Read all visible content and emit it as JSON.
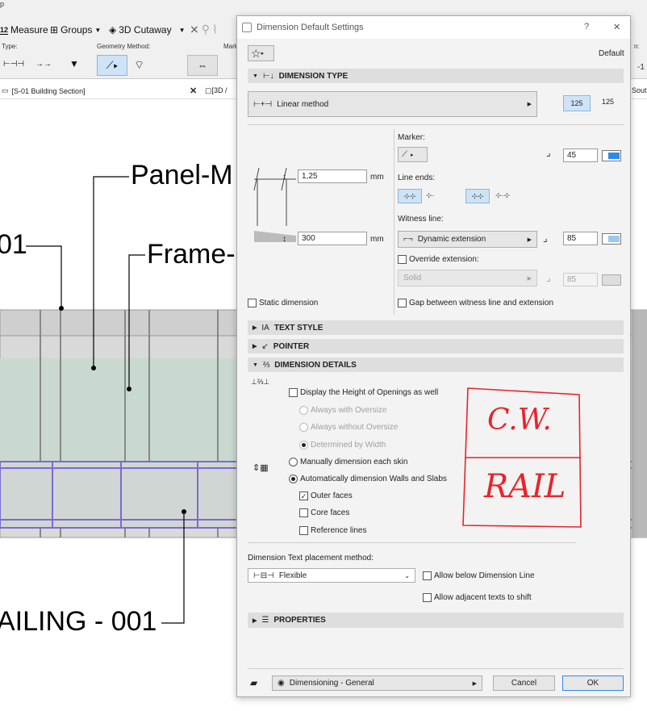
{
  "toolbar": {
    "measure": "Measure",
    "groups": "Groups",
    "cutaway": "3D Cutaway",
    "type_label": "Type:",
    "geometry_label": "Geometry Method:",
    "mark_label": "Mark",
    "tab_label": "[S-01 Building Section]",
    "tab2_label": "[3D /"
  },
  "canvas": {
    "label_01": "01",
    "label_panel": "Panel-M",
    "label_frame": "Frame-",
    "label_railing": "AILING - 001",
    "handwriting_cw": "C.W.",
    "handwriting_rail": "RAIL"
  },
  "dialog": {
    "title": "Dimension Default Settings",
    "help": "?",
    "close": "✕",
    "default_label": "Default",
    "sections": {
      "dimension_type": "DIMENSION TYPE",
      "text_style": "TEXT STYLE",
      "pointer": "POINTER",
      "dimension_details": "DIMENSION DETAILS",
      "properties": "PROPERTIES"
    },
    "dim_type": {
      "method": "Linear method",
      "preview_a": "125",
      "preview_b": "125"
    },
    "geometry": {
      "offset_value": "1,25",
      "offset_unit": "mm",
      "witness_value": "300",
      "witness_unit": "mm",
      "static_dimension": "Static dimension"
    },
    "marker": {
      "label": "Marker:",
      "size": "45",
      "line_ends_label": "Line ends:",
      "witness_label": "Witness line:",
      "witness_method": "Dynamic extension",
      "witness_pen": "85",
      "override_label": "Override extension:",
      "override_style": "Solid",
      "override_pen": "85",
      "gap_label": "Gap between witness line and extension"
    },
    "details": {
      "display_openings": "Display the Height of Openings as well",
      "always_oversize": "Always with Oversize",
      "without_oversize": "Always without Oversize",
      "by_width": "Determined by Width",
      "manual_skin": "Manually dimension each skin",
      "auto_walls": "Automatically dimension Walls and Slabs",
      "outer_faces": "Outer faces",
      "core_faces": "Core faces",
      "reference_lines": "Reference lines"
    },
    "placement": {
      "label": "Dimension Text placement method:",
      "value": "Flexible",
      "allow_below": "Allow below Dimension Line",
      "allow_adjacent": "Allow adjacent texts to shift"
    },
    "footer": {
      "favorite": "Dimensioning - General",
      "cancel": "Cancel",
      "ok": "OK"
    }
  },
  "colors": {
    "accent": "#2e8be8",
    "handwriting": "#e8242a",
    "facade_glass": "#c9d9d0",
    "railing": "#7a6ad6"
  }
}
